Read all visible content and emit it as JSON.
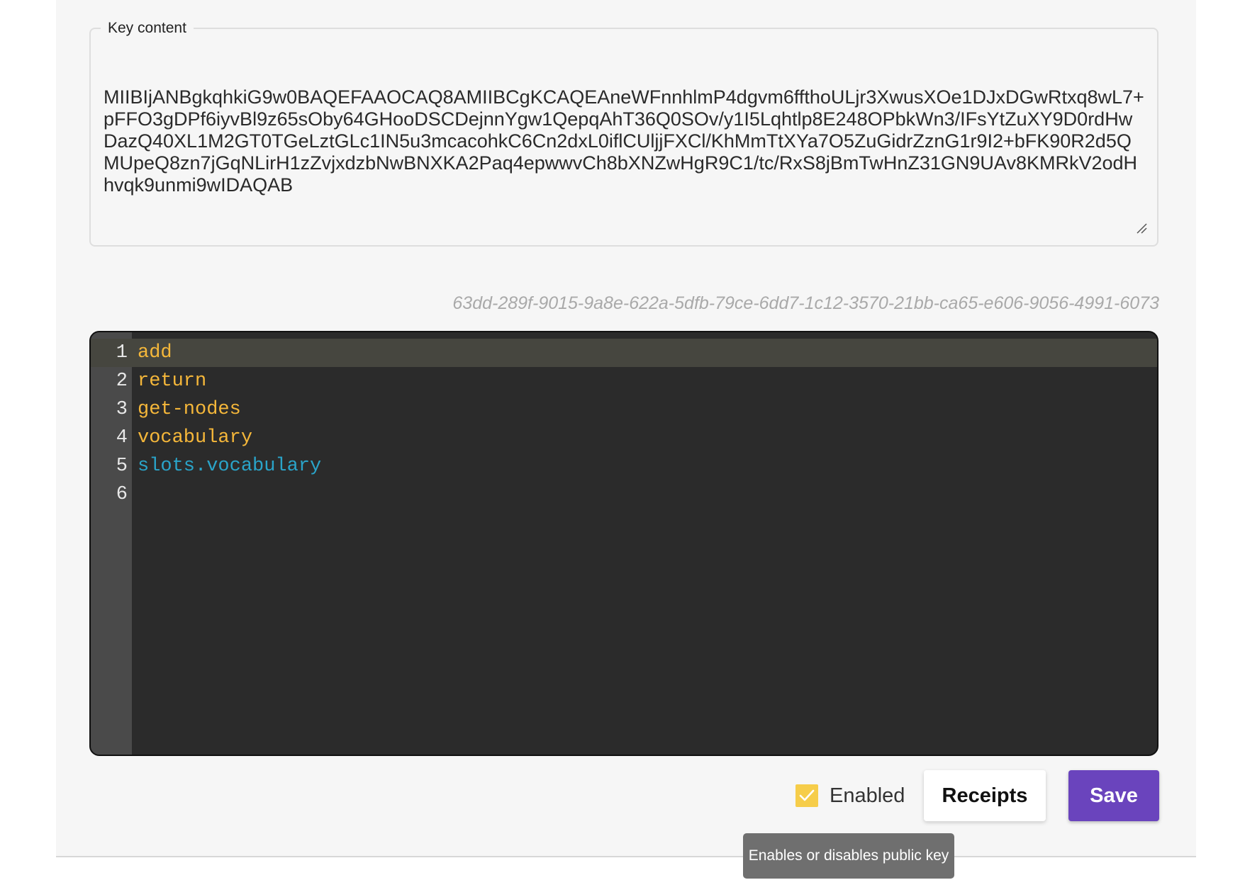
{
  "key_section": {
    "legend": "Key content",
    "value": "MIIBIjANBgkqhkiG9w0BAQEFAAOCAQ8AMIIBCgKCAQEAneWFnnhlmP4dgvm6ffthoULjr3XwusXOe1DJxDGwRtxq8wL7+pFFO3gDPf6iyvBl9z65sOby64GHooDSCDejnnYgw1QepqAhT36Q0SOv/y1I5Lqhtlp8E248OPbkWn3/IFsYtZuXY9D0rdHwDazQ40XL1M2GT0TGeLztGLc1IN5u3mcacohkC6Cn2dxL0iflCUljjFXCl/KhMmTtXYa7O5ZuGidrZznG1r9I2+bFK90R2d5QMUpeQ8zn7jGqNLirH1zZvjxdzbNwBNXKA2Paq4epwwvCh8bXNZwHgR9C1/tc/RxS8jBmTwHnZ31GN9UAv8KMRkV2odHhvqk9unmi9wIDAQAB"
  },
  "key_id": "63dd-289f-9015-9a8e-622a-5dfb-79ce-6dd7-1c12-3570-21bb-ca65-e606-9056-4991-6073",
  "editor": {
    "lines": [
      {
        "number": "1",
        "text": "add",
        "token": "keyword"
      },
      {
        "number": "2",
        "text": "return",
        "token": "keyword"
      },
      {
        "number": "3",
        "text": "get-nodes",
        "token": "keyword"
      },
      {
        "number": "4",
        "text": "vocabulary",
        "token": "keyword"
      },
      {
        "number": "5",
        "text": "slots.vocabulary",
        "token": "variable"
      },
      {
        "number": "6",
        "text": "",
        "token": "keyword"
      }
    ],
    "active_line": 1,
    "colors": {
      "keyword": "#f5b73a",
      "variable": "#2aa4c9",
      "background": "#2b2b2b",
      "gutter": "#4a4a4a"
    }
  },
  "controls": {
    "enabled_label": "Enabled",
    "enabled_checked": true,
    "receipts_label": "Receipts",
    "save_label": "Save",
    "tooltip": "Enables or disables public key"
  },
  "colors": {
    "accent": "#6a44bd",
    "checkbox": "#f6cd4a"
  },
  "icons": {
    "check": "check-icon",
    "resize": "resize-grip-icon"
  }
}
